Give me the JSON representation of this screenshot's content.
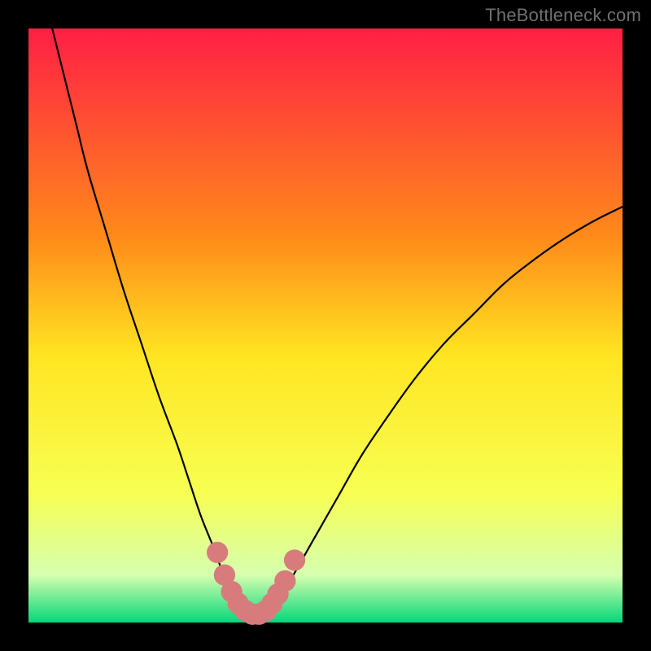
{
  "watermark": "TheBottleneck.com",
  "colors": {
    "frame": "#000000",
    "grad_top": "#ff1f45",
    "grad_upper_mid": "#ff8a1a",
    "grad_mid": "#ffe521",
    "grad_lower_mid": "#f7ff52",
    "grad_low": "#d6ffb0",
    "grad_bottom": "#05d67a",
    "curve": "#000000",
    "marker_fill": "#d87b7c",
    "marker_stroke": "#d87b7c"
  },
  "chart_data": {
    "type": "line",
    "title": "",
    "xlabel": "",
    "ylabel": "",
    "xlim": [
      0,
      100
    ],
    "ylim": [
      0,
      100
    ],
    "grid": false,
    "legend": false,
    "series": [
      {
        "name": "bottleneck-curve",
        "x": [
          4,
          6,
          8,
          10,
          13,
          16,
          19,
          22,
          25,
          27,
          29,
          31,
          32.5,
          34,
          35.5,
          37,
          38,
          39,
          40,
          42,
          44,
          48,
          52,
          56,
          60,
          65,
          70,
          75,
          80,
          85,
          90,
          95,
          100
        ],
        "y": [
          100,
          92,
          84,
          76,
          66,
          56,
          47,
          38,
          30,
          24,
          18,
          13,
          9,
          6,
          3.5,
          1.8,
          1.2,
          1.2,
          2,
          4,
          7,
          14,
          21,
          28,
          34,
          41,
          47,
          52,
          57,
          61,
          64.5,
          67.5,
          70
        ]
      }
    ],
    "markers": {
      "name": "highlight-band",
      "points": [
        {
          "x": 31.8,
          "y": 11.8
        },
        {
          "x": 33.0,
          "y": 8.0
        },
        {
          "x": 34.2,
          "y": 5.2
        },
        {
          "x": 35.3,
          "y": 3.2
        },
        {
          "x": 36.5,
          "y": 2.0
        },
        {
          "x": 37.7,
          "y": 1.4
        },
        {
          "x": 38.8,
          "y": 1.4
        },
        {
          "x": 40.0,
          "y": 2.0
        },
        {
          "x": 41.0,
          "y": 3.2
        },
        {
          "x": 42.0,
          "y": 4.8
        },
        {
          "x": 43.2,
          "y": 7.0
        },
        {
          "x": 44.8,
          "y": 10.5
        }
      ],
      "radius": 2.0
    }
  }
}
